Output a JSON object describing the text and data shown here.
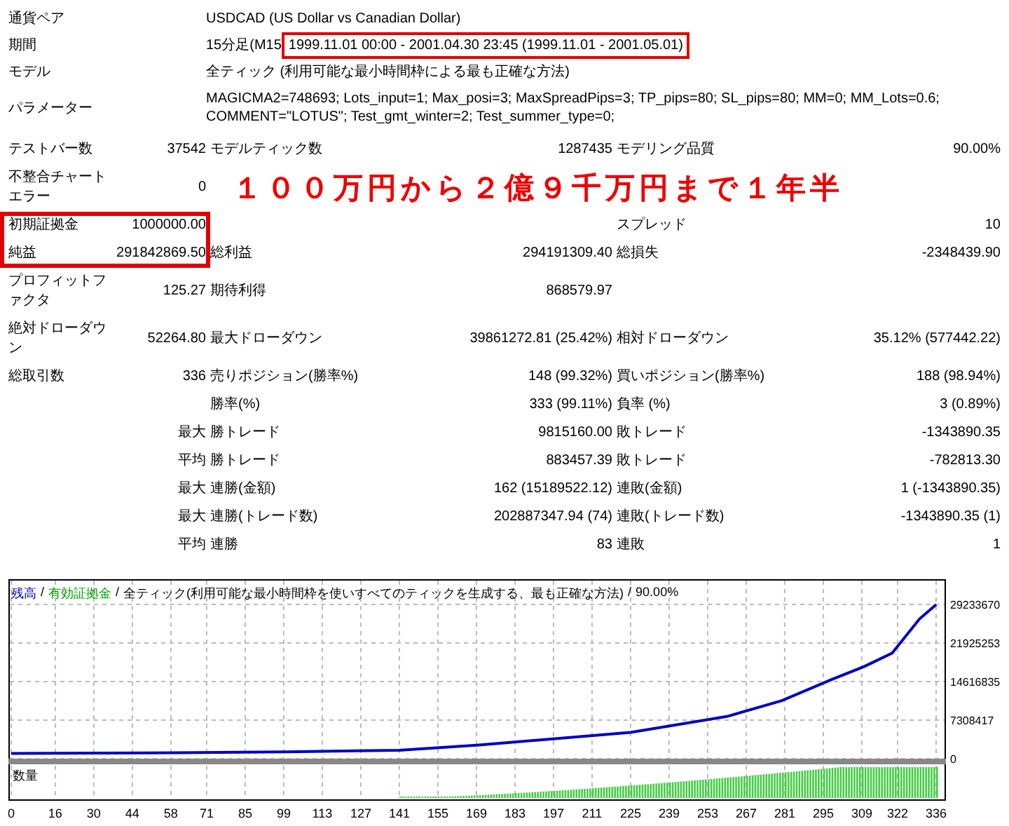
{
  "header": [
    {
      "label": "通貨ペア",
      "value": "USDCAD (US Dollar vs Canadian Dollar)",
      "highlighted": false
    },
    {
      "label": "期間",
      "value": "15分足(M15",
      "range": "1999.11.01 00:00 - 2001.04.30 23:45 (1999.11.01 - 2001.05.01)",
      "highlighted": true
    },
    {
      "label": "モデル",
      "value": "全ティック (利用可能な最小時間枠による最も正確な方法)",
      "highlighted": false
    },
    {
      "label": "パラメーター",
      "value_lines": [
        "MAGICMA2=748693; Lots_input=1; Max_posi=3; MaxSpreadPips=3; TP_pips=80; SL_pips=80; MM=0; MM_Lots=0.6;",
        "COMMENT=\"LOTUS\"; Test_gmt_winter=2; Test_summer_type=0;"
      ],
      "highlighted": false
    }
  ],
  "stats": [
    {
      "label": "テストバー数",
      "value": "37542",
      "label_2": "モデルティック数",
      "value_2": "1287435",
      "label_3": "モデリング品質",
      "value_3": "90.00%",
      "highlighted": false
    },
    {
      "label": "不整合チャートエラー",
      "value": "0",
      "banner": "１００万円から２億９千万円まで１年半",
      "highlighted": false
    },
    {
      "label": "初期証拠金",
      "value": "1000000.00",
      "label_3": "スプレッド",
      "value_3": "10",
      "highlighted": true
    },
    {
      "label": "純益",
      "value": "291842869.50",
      "label_2": "総利益",
      "value_2": "294191309.40",
      "label_3": "総損失",
      "value_3": "-2348439.90",
      "highlighted": true
    },
    {
      "label": "プロフィットファクタ",
      "value": "125.27",
      "label_2": "期待利得",
      "value_2": "868579.97",
      "highlighted": false
    },
    {
      "label": "絶対ドローダウン",
      "value": "52264.80",
      "label_2": "最大ドローダウン",
      "value_2": "39861272.81 (25.42%)",
      "label_3": "相対ドローダウン",
      "value_3": "35.12% (577442.22)",
      "highlighted": false
    },
    {
      "label": "総取引数",
      "value": "336",
      "label_2": "売りポジション(勝率%)",
      "value_2": "148 (99.32%)",
      "label_3": "買いポジション(勝率%)",
      "value_3": "188 (98.94%)",
      "highlighted": false
    },
    {
      "label_2": "勝率(%)",
      "value_2": "333 (99.11%)",
      "label_3": "負率 (%)",
      "value_3": "3 (0.89%)",
      "highlighted": false
    },
    {
      "value": "最大",
      "label_2": "勝トレード",
      "value_2": "9815160.00",
      "label_3": "敗トレード",
      "value_3": "-1343890.35",
      "highlighted": false
    },
    {
      "value": "平均",
      "label_2": "勝トレード",
      "value_2": "883457.39",
      "label_3": "敗トレード",
      "value_3": "-782813.30",
      "highlighted": false
    },
    {
      "value": "最大",
      "label_2": "連勝(金額)",
      "value_2": "162 (15189522.12)",
      "label_3": "連敗(金額)",
      "value_3": "1 (-1343890.35)",
      "highlighted": false
    },
    {
      "value": "最大",
      "label_2": "連勝(トレード数)",
      "value_2": "202887347.94 (74)",
      "label_3": "連敗(トレード数)",
      "value_3": "-1343890.35 (1)",
      "highlighted": false
    },
    {
      "value": "平均",
      "label_2": "連勝",
      "value_2": "83",
      "label_3": "連敗",
      "value_3": "1",
      "highlighted": false
    }
  ],
  "chart": {
    "separator": "/",
    "notes": [
      {
        "text": "有効証拠金",
        "color": "#00a000"
      },
      {
        "text": "全ティック(利用可能な最小時間枠を使いすべてのティックを生成する、最も正確な方法)",
        "color": "#000000"
      },
      {
        "text": "90.00%",
        "color": "#000000"
      }
    ],
    "volume_label": "数量",
    "chart_data": {
      "type": "line",
      "x": [
        0,
        50,
        100,
        141,
        170,
        193,
        225,
        260,
        280,
        298,
        310,
        320,
        330,
        336
      ],
      "series": [
        {
          "name": "残高",
          "color": "#0000c0",
          "values": [
            1000000,
            1100000,
            1300000,
            1600000,
            2600000,
            3600000,
            5000000,
            8000000,
            11000000,
            15000000,
            17500000,
            20000000,
            26500000,
            29200000
          ]
        }
      ],
      "xlim": [
        0,
        336
      ],
      "ylim": [
        0,
        29233670
      ],
      "grid": true,
      "yticks": [
        0,
        7308417,
        14616835,
        21925253,
        29233670
      ],
      "xticks": [
        0,
        16,
        30,
        44,
        58,
        71,
        85,
        99,
        113,
        127,
        141,
        155,
        169,
        183,
        197,
        211,
        225,
        239,
        253,
        267,
        281,
        295,
        309,
        322,
        336
      ]
    }
  }
}
